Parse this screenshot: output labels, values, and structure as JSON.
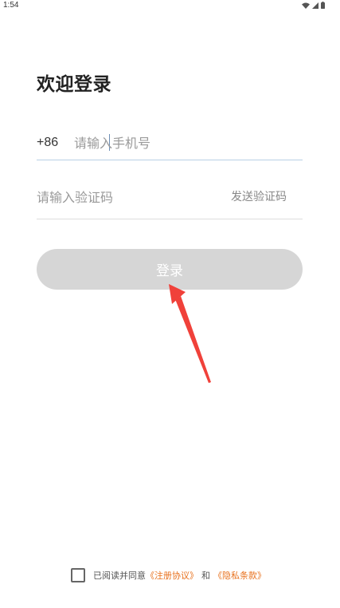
{
  "status_bar": {
    "time": "1:54",
    "icons": [
      "wifi-icon",
      "signal-icon",
      "battery-icon"
    ]
  },
  "title": "欢迎登录",
  "phone": {
    "country_code": "+86",
    "placeholder": "请输入手机号",
    "value": ""
  },
  "code": {
    "placeholder": "请输入验证码",
    "value": "",
    "send_label": "发送验证码"
  },
  "login_label": "登录",
  "agreement": {
    "checked": false,
    "prefix": "已阅读并同意",
    "register_link": "《注册协议》",
    "and": "和",
    "privacy_link": "《隐私条款》"
  },
  "colors": {
    "link": "#e8721f",
    "button_disabled": "#d6d6d6",
    "annotation_arrow": "#f0413a",
    "active_underline": "#b9cfe6"
  }
}
